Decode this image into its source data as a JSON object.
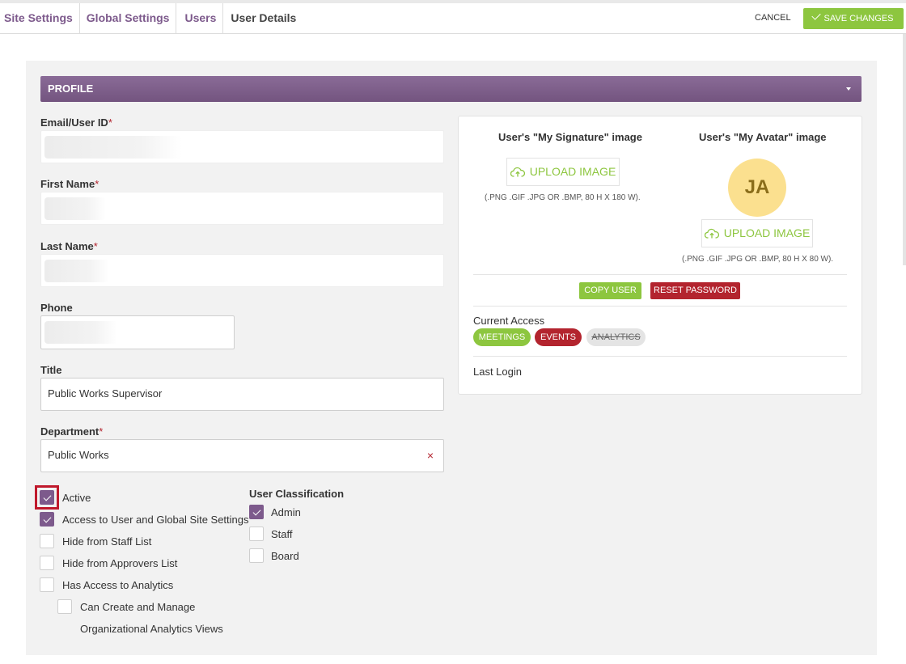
{
  "breadcrumbs": [
    "Site Settings",
    "Global Settings",
    "Users",
    "User Details"
  ],
  "toolbar": {
    "cancel_label": "CANCEL",
    "save_label": "SAVE CHANGES"
  },
  "profile": {
    "section_title": "PROFILE",
    "fields": {
      "email_label": "Email/User ID",
      "first_name_label": "First Name",
      "last_name_label": "Last Name",
      "phone_label": "Phone",
      "title_label": "Title",
      "title_value": "Public Works Supervisor",
      "department_label": "Department",
      "department_value": "Public Works",
      "required_mark": "*",
      "clear_symbol": "×"
    },
    "options": [
      {
        "label": "Active",
        "checked": true
      },
      {
        "label": "Access to User and Global Site Settings",
        "checked": true
      },
      {
        "label": "Hide from Staff List",
        "checked": false
      },
      {
        "label": "Hide from Approvers List",
        "checked": false
      },
      {
        "label": "Has Access to Analytics",
        "checked": false
      },
      {
        "label": "Can Create and Manage",
        "label_line2": "Organizational Analytics Views",
        "checked": false
      }
    ],
    "classification": {
      "title": "User Classification",
      "items": [
        {
          "label": "Admin",
          "checked": true
        },
        {
          "label": "Staff",
          "checked": false
        },
        {
          "label": "Board",
          "checked": false
        }
      ]
    }
  },
  "panel": {
    "signature_title": "User's \"My Signature\" image",
    "avatar_title": "User's \"My Avatar\" image",
    "upload_label": "UPLOAD IMAGE",
    "signature_hint": "(.PNG .GIF .JPG OR .BMP, 80 H X 180 W).",
    "avatar_hint": "(.PNG .GIF .JPG OR .BMP, 80 H X 80 W).",
    "avatar_initials": "JA",
    "copy_user_label": "COPY USER",
    "reset_password_label": "RESET PASSWORD",
    "current_access_label": "Current Access",
    "access": [
      {
        "label": "MEETINGS",
        "color": "#8dc63f",
        "active": true
      },
      {
        "label": "EVENTS",
        "color": "#b3242e",
        "active": true
      },
      {
        "label": "ANALYTICS",
        "color": "#e4e4e4",
        "active": false
      }
    ],
    "last_login_label": "Last Login"
  },
  "colors": {
    "accent_purple": "#7d5a8c",
    "accent_green": "#8dc63f",
    "danger_red": "#b3242e"
  }
}
